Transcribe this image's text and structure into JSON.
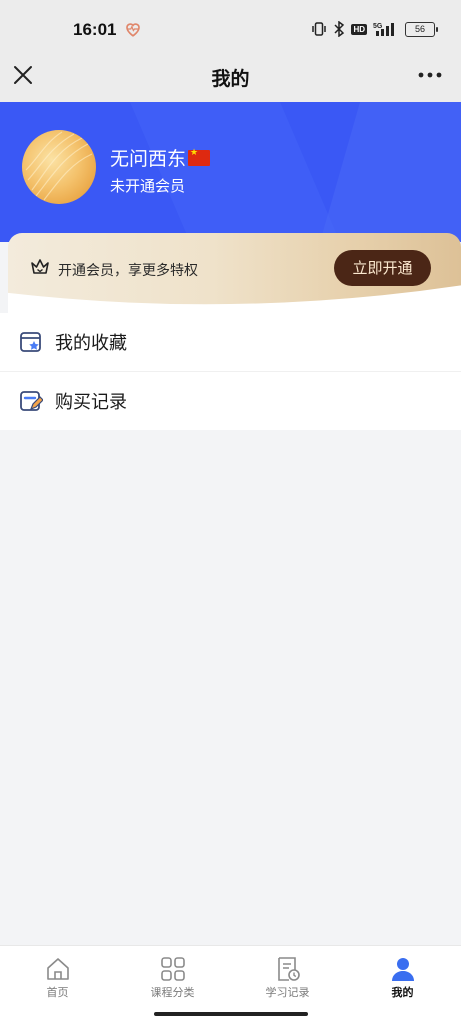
{
  "status_bar": {
    "time": "16:01",
    "battery": "56",
    "hd": "HD"
  },
  "nav": {
    "title": "我的"
  },
  "profile": {
    "username": "无问西东",
    "member_status": "未开通会员"
  },
  "vip": {
    "promo_text": "开通会员，享更多特权",
    "button_label": "立即开通"
  },
  "menu": {
    "items": [
      {
        "label": "我的收藏",
        "icon": "favorites-icon"
      },
      {
        "label": "购买记录",
        "icon": "purchase-record-icon"
      }
    ]
  },
  "tabs": [
    {
      "label": "首页",
      "icon": "home-icon",
      "active": false
    },
    {
      "label": "课程分类",
      "icon": "grid-icon",
      "active": false
    },
    {
      "label": "学习记录",
      "icon": "study-record-icon",
      "active": false
    },
    {
      "label": "我的",
      "icon": "person-icon",
      "active": true
    }
  ],
  "colors": {
    "header_blue": "#3a58f5",
    "vip_button": "#4b2616",
    "active_tab": "#3a6ef0"
  }
}
